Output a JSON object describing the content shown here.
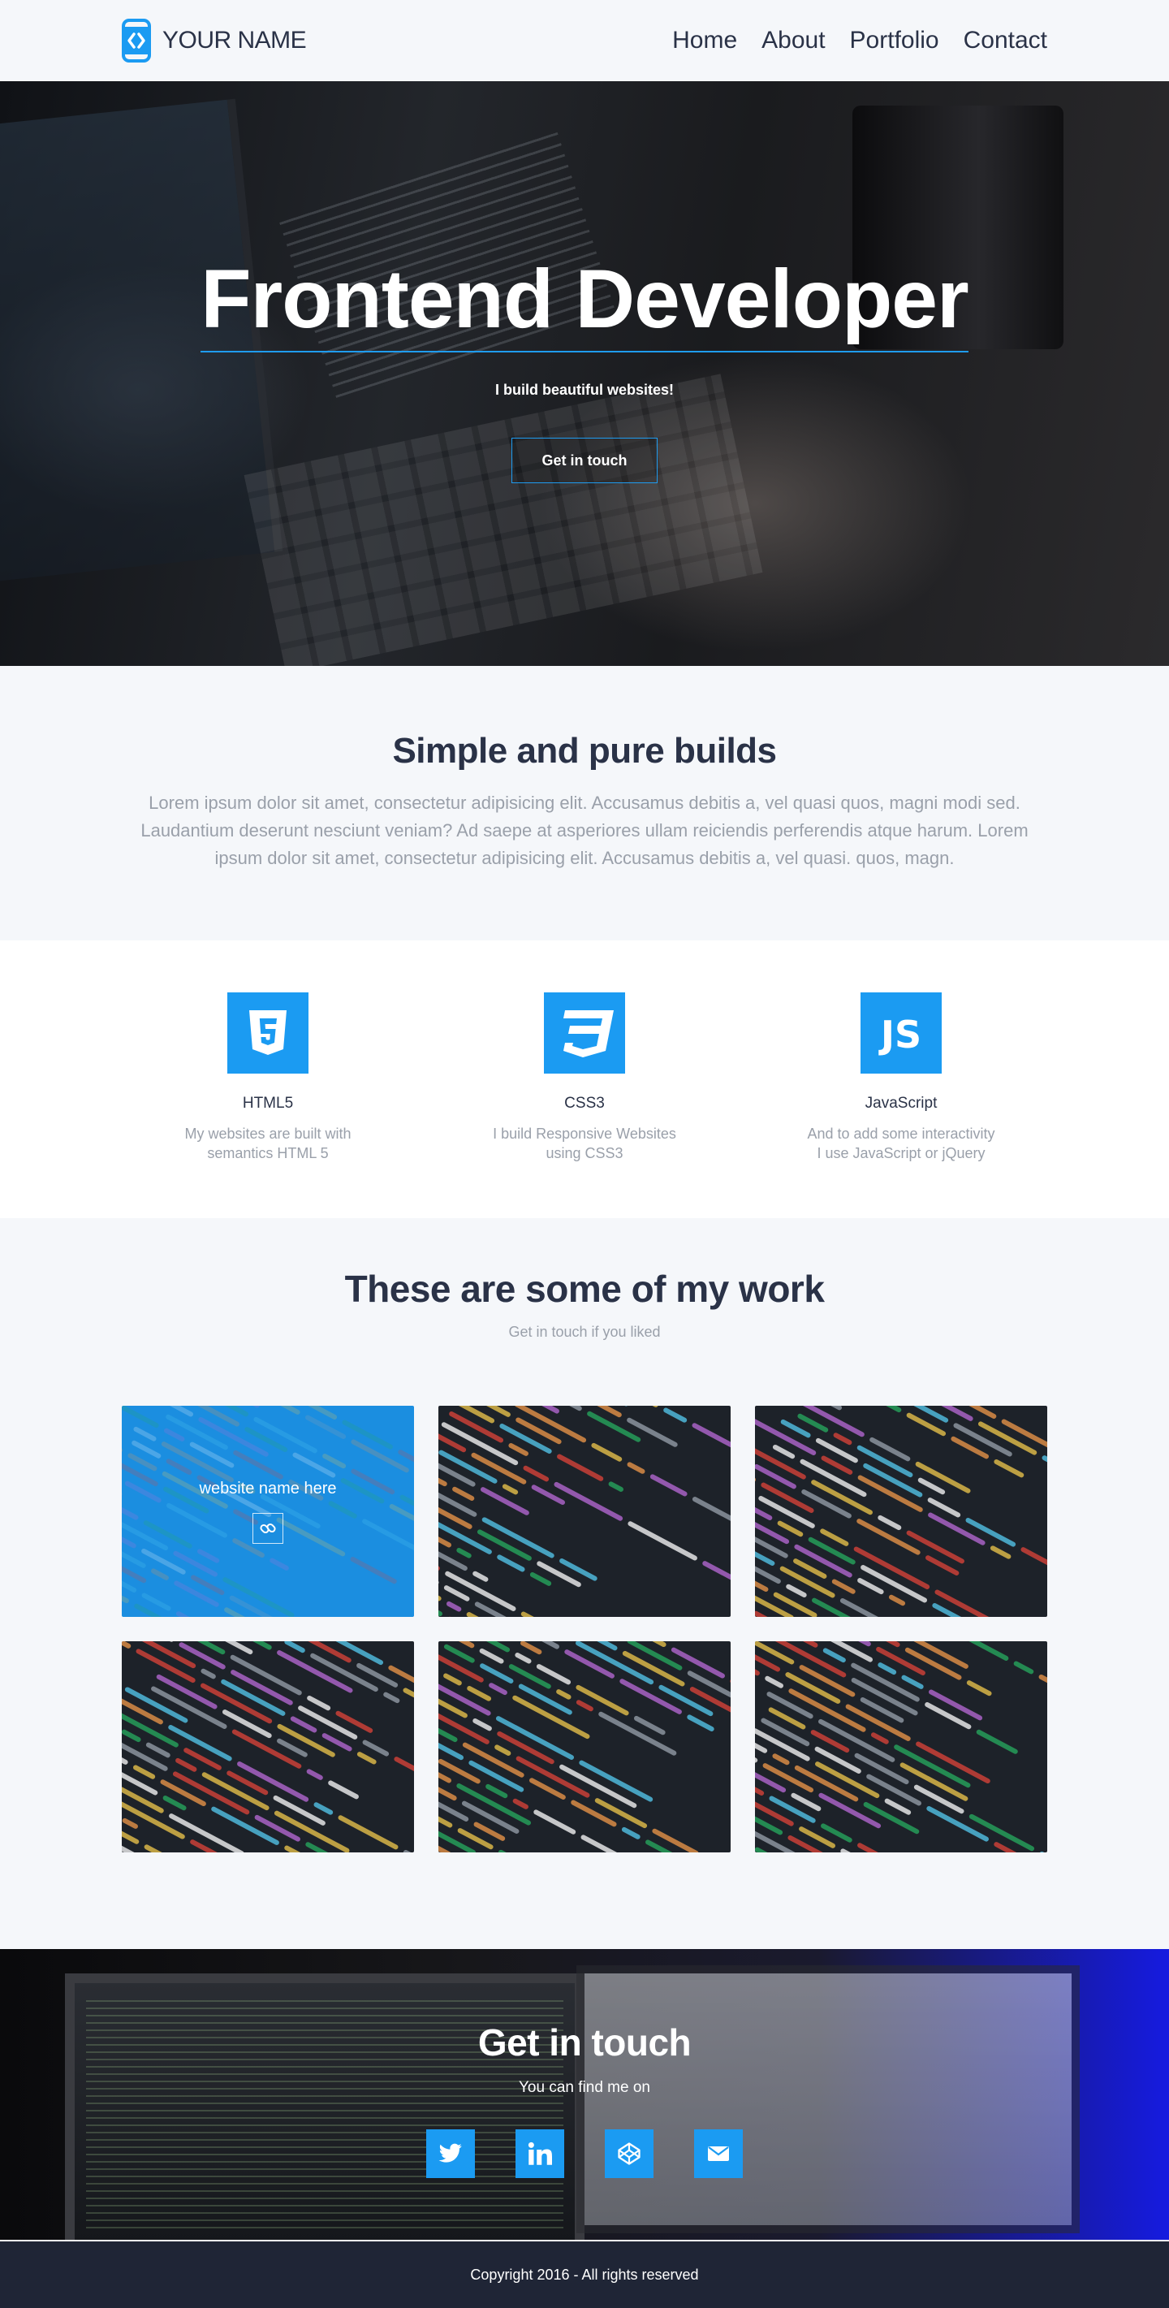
{
  "nav": {
    "brand_name": "YOUR NAME",
    "logo_icon": "code-bracket-logo-icon",
    "items": [
      {
        "label": "Home"
      },
      {
        "label": "About"
      },
      {
        "label": "Portfolio"
      },
      {
        "label": "Contact"
      }
    ]
  },
  "hero": {
    "title": "Frontend Developer",
    "subtitle": "I build beautiful websites!",
    "button_label": "Get in touch"
  },
  "intro": {
    "title": "Simple and pure builds",
    "text": "Lorem ipsum dolor sit amet, consectetur adipisicing elit. Accusamus debitis a, vel quasi quos, magni modi sed. Laudantium deserunt nesciunt veniam? Ad saepe at asperiores ullam reiciendis perferendis atque harum. Lorem ipsum dolor sit amet, consectetur adipisicing elit. Accusamus debitis a, vel quasi. quos, magn."
  },
  "skills": [
    {
      "icon": "html5-icon",
      "title": "HTML5",
      "desc": "My websites are built with semantics HTML 5"
    },
    {
      "icon": "css3-icon",
      "title": "CSS3",
      "desc": "I build Responsive Websites using CSS3"
    },
    {
      "icon": "javascript-icon",
      "title": "JavaScript",
      "desc": "And to add some interactivity I use JavaScript or jQuery"
    }
  ],
  "work": {
    "title": "These are some of my work",
    "subtitle": "Get in touch if you liked",
    "featured_title": "website name here",
    "link_icon": "link-icon"
  },
  "contact": {
    "title": "Get in touch",
    "subtitle": "You can find me on",
    "socials": [
      "twitter-icon",
      "linkedin-icon",
      "codepen-icon",
      "email-icon"
    ]
  },
  "footer": {
    "text": "Copyright 2016 - All rights reserved"
  },
  "colors": {
    "accent": "#1b9bf2",
    "dark_text": "#2a3247",
    "muted_text": "#9aa0aa",
    "footer_bg": "#1f2536"
  }
}
